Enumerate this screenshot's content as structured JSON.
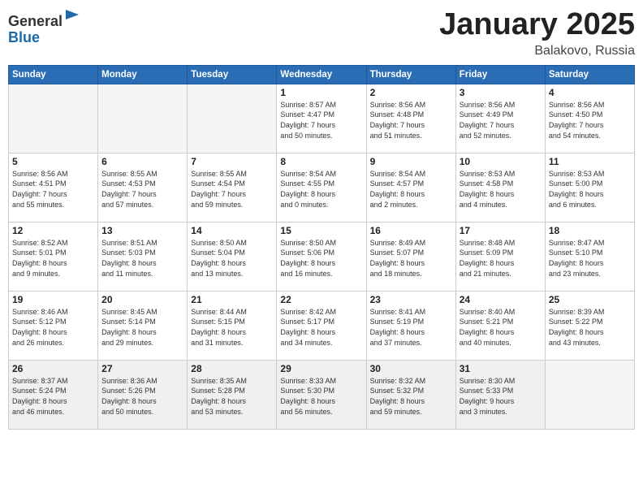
{
  "logo": {
    "general": "General",
    "blue": "Blue"
  },
  "header": {
    "month": "January 2025",
    "location": "Balakovo, Russia"
  },
  "weekdays": [
    "Sunday",
    "Monday",
    "Tuesday",
    "Wednesday",
    "Thursday",
    "Friday",
    "Saturday"
  ],
  "weeks": [
    [
      {
        "day": "",
        "info": ""
      },
      {
        "day": "",
        "info": ""
      },
      {
        "day": "",
        "info": ""
      },
      {
        "day": "1",
        "info": "Sunrise: 8:57 AM\nSunset: 4:47 PM\nDaylight: 7 hours\nand 50 minutes."
      },
      {
        "day": "2",
        "info": "Sunrise: 8:56 AM\nSunset: 4:48 PM\nDaylight: 7 hours\nand 51 minutes."
      },
      {
        "day": "3",
        "info": "Sunrise: 8:56 AM\nSunset: 4:49 PM\nDaylight: 7 hours\nand 52 minutes."
      },
      {
        "day": "4",
        "info": "Sunrise: 8:56 AM\nSunset: 4:50 PM\nDaylight: 7 hours\nand 54 minutes."
      }
    ],
    [
      {
        "day": "5",
        "info": "Sunrise: 8:56 AM\nSunset: 4:51 PM\nDaylight: 7 hours\nand 55 minutes."
      },
      {
        "day": "6",
        "info": "Sunrise: 8:55 AM\nSunset: 4:53 PM\nDaylight: 7 hours\nand 57 minutes."
      },
      {
        "day": "7",
        "info": "Sunrise: 8:55 AM\nSunset: 4:54 PM\nDaylight: 7 hours\nand 59 minutes."
      },
      {
        "day": "8",
        "info": "Sunrise: 8:54 AM\nSunset: 4:55 PM\nDaylight: 8 hours\nand 0 minutes."
      },
      {
        "day": "9",
        "info": "Sunrise: 8:54 AM\nSunset: 4:57 PM\nDaylight: 8 hours\nand 2 minutes."
      },
      {
        "day": "10",
        "info": "Sunrise: 8:53 AM\nSunset: 4:58 PM\nDaylight: 8 hours\nand 4 minutes."
      },
      {
        "day": "11",
        "info": "Sunrise: 8:53 AM\nSunset: 5:00 PM\nDaylight: 8 hours\nand 6 minutes."
      }
    ],
    [
      {
        "day": "12",
        "info": "Sunrise: 8:52 AM\nSunset: 5:01 PM\nDaylight: 8 hours\nand 9 minutes."
      },
      {
        "day": "13",
        "info": "Sunrise: 8:51 AM\nSunset: 5:03 PM\nDaylight: 8 hours\nand 11 minutes."
      },
      {
        "day": "14",
        "info": "Sunrise: 8:50 AM\nSunset: 5:04 PM\nDaylight: 8 hours\nand 13 minutes."
      },
      {
        "day": "15",
        "info": "Sunrise: 8:50 AM\nSunset: 5:06 PM\nDaylight: 8 hours\nand 16 minutes."
      },
      {
        "day": "16",
        "info": "Sunrise: 8:49 AM\nSunset: 5:07 PM\nDaylight: 8 hours\nand 18 minutes."
      },
      {
        "day": "17",
        "info": "Sunrise: 8:48 AM\nSunset: 5:09 PM\nDaylight: 8 hours\nand 21 minutes."
      },
      {
        "day": "18",
        "info": "Sunrise: 8:47 AM\nSunset: 5:10 PM\nDaylight: 8 hours\nand 23 minutes."
      }
    ],
    [
      {
        "day": "19",
        "info": "Sunrise: 8:46 AM\nSunset: 5:12 PM\nDaylight: 8 hours\nand 26 minutes."
      },
      {
        "day": "20",
        "info": "Sunrise: 8:45 AM\nSunset: 5:14 PM\nDaylight: 8 hours\nand 29 minutes."
      },
      {
        "day": "21",
        "info": "Sunrise: 8:44 AM\nSunset: 5:15 PM\nDaylight: 8 hours\nand 31 minutes."
      },
      {
        "day": "22",
        "info": "Sunrise: 8:42 AM\nSunset: 5:17 PM\nDaylight: 8 hours\nand 34 minutes."
      },
      {
        "day": "23",
        "info": "Sunrise: 8:41 AM\nSunset: 5:19 PM\nDaylight: 8 hours\nand 37 minutes."
      },
      {
        "day": "24",
        "info": "Sunrise: 8:40 AM\nSunset: 5:21 PM\nDaylight: 8 hours\nand 40 minutes."
      },
      {
        "day": "25",
        "info": "Sunrise: 8:39 AM\nSunset: 5:22 PM\nDaylight: 8 hours\nand 43 minutes."
      }
    ],
    [
      {
        "day": "26",
        "info": "Sunrise: 8:37 AM\nSunset: 5:24 PM\nDaylight: 8 hours\nand 46 minutes."
      },
      {
        "day": "27",
        "info": "Sunrise: 8:36 AM\nSunset: 5:26 PM\nDaylight: 8 hours\nand 50 minutes."
      },
      {
        "day": "28",
        "info": "Sunrise: 8:35 AM\nSunset: 5:28 PM\nDaylight: 8 hours\nand 53 minutes."
      },
      {
        "day": "29",
        "info": "Sunrise: 8:33 AM\nSunset: 5:30 PM\nDaylight: 8 hours\nand 56 minutes."
      },
      {
        "day": "30",
        "info": "Sunrise: 8:32 AM\nSunset: 5:32 PM\nDaylight: 8 hours\nand 59 minutes."
      },
      {
        "day": "31",
        "info": "Sunrise: 8:30 AM\nSunset: 5:33 PM\nDaylight: 9 hours\nand 3 minutes."
      },
      {
        "day": "",
        "info": ""
      }
    ]
  ]
}
